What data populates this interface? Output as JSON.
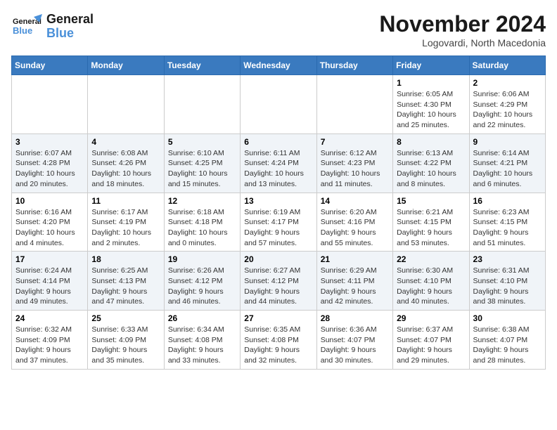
{
  "header": {
    "logo_line1": "General",
    "logo_line2": "Blue",
    "month": "November 2024",
    "location": "Logovardi, North Macedonia"
  },
  "weekdays": [
    "Sunday",
    "Monday",
    "Tuesday",
    "Wednesday",
    "Thursday",
    "Friday",
    "Saturday"
  ],
  "weeks": [
    [
      {
        "day": "",
        "info": ""
      },
      {
        "day": "",
        "info": ""
      },
      {
        "day": "",
        "info": ""
      },
      {
        "day": "",
        "info": ""
      },
      {
        "day": "",
        "info": ""
      },
      {
        "day": "1",
        "info": "Sunrise: 6:05 AM\nSunset: 4:30 PM\nDaylight: 10 hours and 25 minutes."
      },
      {
        "day": "2",
        "info": "Sunrise: 6:06 AM\nSunset: 4:29 PM\nDaylight: 10 hours and 22 minutes."
      }
    ],
    [
      {
        "day": "3",
        "info": "Sunrise: 6:07 AM\nSunset: 4:28 PM\nDaylight: 10 hours and 20 minutes."
      },
      {
        "day": "4",
        "info": "Sunrise: 6:08 AM\nSunset: 4:26 PM\nDaylight: 10 hours and 18 minutes."
      },
      {
        "day": "5",
        "info": "Sunrise: 6:10 AM\nSunset: 4:25 PM\nDaylight: 10 hours and 15 minutes."
      },
      {
        "day": "6",
        "info": "Sunrise: 6:11 AM\nSunset: 4:24 PM\nDaylight: 10 hours and 13 minutes."
      },
      {
        "day": "7",
        "info": "Sunrise: 6:12 AM\nSunset: 4:23 PM\nDaylight: 10 hours and 11 minutes."
      },
      {
        "day": "8",
        "info": "Sunrise: 6:13 AM\nSunset: 4:22 PM\nDaylight: 10 hours and 8 minutes."
      },
      {
        "day": "9",
        "info": "Sunrise: 6:14 AM\nSunset: 4:21 PM\nDaylight: 10 hours and 6 minutes."
      }
    ],
    [
      {
        "day": "10",
        "info": "Sunrise: 6:16 AM\nSunset: 4:20 PM\nDaylight: 10 hours and 4 minutes."
      },
      {
        "day": "11",
        "info": "Sunrise: 6:17 AM\nSunset: 4:19 PM\nDaylight: 10 hours and 2 minutes."
      },
      {
        "day": "12",
        "info": "Sunrise: 6:18 AM\nSunset: 4:18 PM\nDaylight: 10 hours and 0 minutes."
      },
      {
        "day": "13",
        "info": "Sunrise: 6:19 AM\nSunset: 4:17 PM\nDaylight: 9 hours and 57 minutes."
      },
      {
        "day": "14",
        "info": "Sunrise: 6:20 AM\nSunset: 4:16 PM\nDaylight: 9 hours and 55 minutes."
      },
      {
        "day": "15",
        "info": "Sunrise: 6:21 AM\nSunset: 4:15 PM\nDaylight: 9 hours and 53 minutes."
      },
      {
        "day": "16",
        "info": "Sunrise: 6:23 AM\nSunset: 4:15 PM\nDaylight: 9 hours and 51 minutes."
      }
    ],
    [
      {
        "day": "17",
        "info": "Sunrise: 6:24 AM\nSunset: 4:14 PM\nDaylight: 9 hours and 49 minutes."
      },
      {
        "day": "18",
        "info": "Sunrise: 6:25 AM\nSunset: 4:13 PM\nDaylight: 9 hours and 47 minutes."
      },
      {
        "day": "19",
        "info": "Sunrise: 6:26 AM\nSunset: 4:12 PM\nDaylight: 9 hours and 46 minutes."
      },
      {
        "day": "20",
        "info": "Sunrise: 6:27 AM\nSunset: 4:12 PM\nDaylight: 9 hours and 44 minutes."
      },
      {
        "day": "21",
        "info": "Sunrise: 6:29 AM\nSunset: 4:11 PM\nDaylight: 9 hours and 42 minutes."
      },
      {
        "day": "22",
        "info": "Sunrise: 6:30 AM\nSunset: 4:10 PM\nDaylight: 9 hours and 40 minutes."
      },
      {
        "day": "23",
        "info": "Sunrise: 6:31 AM\nSunset: 4:10 PM\nDaylight: 9 hours and 38 minutes."
      }
    ],
    [
      {
        "day": "24",
        "info": "Sunrise: 6:32 AM\nSunset: 4:09 PM\nDaylight: 9 hours and 37 minutes."
      },
      {
        "day": "25",
        "info": "Sunrise: 6:33 AM\nSunset: 4:09 PM\nDaylight: 9 hours and 35 minutes."
      },
      {
        "day": "26",
        "info": "Sunrise: 6:34 AM\nSunset: 4:08 PM\nDaylight: 9 hours and 33 minutes."
      },
      {
        "day": "27",
        "info": "Sunrise: 6:35 AM\nSunset: 4:08 PM\nDaylight: 9 hours and 32 minutes."
      },
      {
        "day": "28",
        "info": "Sunrise: 6:36 AM\nSunset: 4:07 PM\nDaylight: 9 hours and 30 minutes."
      },
      {
        "day": "29",
        "info": "Sunrise: 6:37 AM\nSunset: 4:07 PM\nDaylight: 9 hours and 29 minutes."
      },
      {
        "day": "30",
        "info": "Sunrise: 6:38 AM\nSunset: 4:07 PM\nDaylight: 9 hours and 28 minutes."
      }
    ]
  ]
}
